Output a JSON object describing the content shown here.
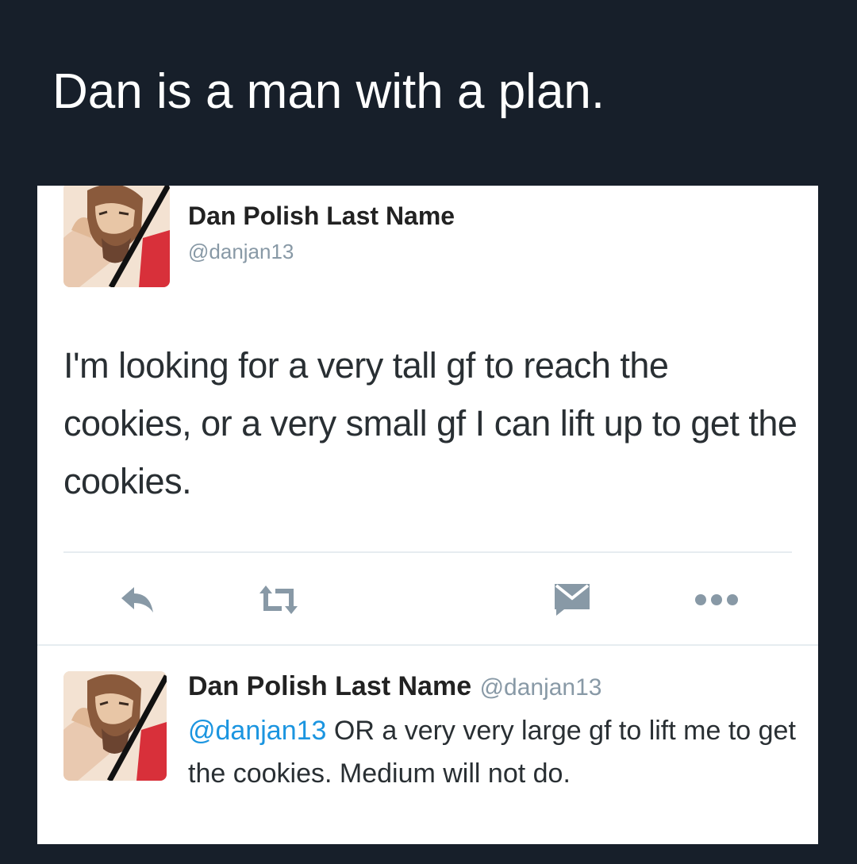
{
  "caption": "Dan is a man with a plan.",
  "main_tweet": {
    "display_name": "Dan Polish Last Name",
    "handle": "@danjan13",
    "text": "I'm looking for a very tall gf to reach the cookies, or a very small gf I can lift up to get the cookies.",
    "actions": [
      "reply-icon",
      "retweet-icon",
      "message-icon",
      "more-icon"
    ]
  },
  "reply_tweet": {
    "display_name": "Dan Polish Last Name",
    "handle": "@danjan13",
    "mention": "@danjan13",
    "text": "OR a very very large gf to lift me to get the cookies. Medium will not do."
  },
  "colors": {
    "background": "#171f2a",
    "card": "#ffffff",
    "mention": "#1b95e0",
    "muted": "#8899a6",
    "icon": "#8899a6"
  }
}
